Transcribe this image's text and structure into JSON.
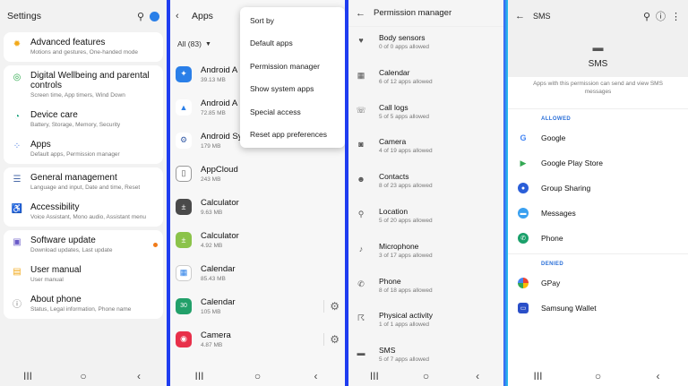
{
  "settings": {
    "title": "Settings",
    "items": [
      {
        "title": "Advanced features",
        "sub": "Motions and gestures, One-handed mode",
        "color": "#f2a91a"
      },
      {
        "title": "Digital Wellbeing and parental controls",
        "sub": "Screen time, App timers, Wind Down",
        "color": "#2aa84a"
      },
      {
        "title": "Device care",
        "sub": "Battery, Storage, Memory, Security",
        "color": "#14a07a"
      },
      {
        "title": "Apps",
        "sub": "Default apps, Permission manager",
        "color": "#3e73e0"
      },
      {
        "title": "General management",
        "sub": "Language and input, Date and time, Reset",
        "color": "#4a6aa8"
      },
      {
        "title": "Accessibility",
        "sub": "Voice Assistant, Mono audio, Assistant menu",
        "color": "#2aa84a"
      },
      {
        "title": "Software update",
        "sub": "Download updates, Last update",
        "color": "#6a5ac8"
      },
      {
        "title": "User manual",
        "sub": "User manual",
        "color": "#f2a91a"
      },
      {
        "title": "About phone",
        "sub": "Status, Legal information, Phone name",
        "color": "#777777"
      }
    ]
  },
  "apps": {
    "title": "Apps",
    "filter": "All (83)",
    "list": [
      {
        "name": "Android A",
        "size": "39.13 MB",
        "color": "#2a7fe8",
        "glyph": "✦"
      },
      {
        "name": "Android A",
        "size": "72.85 MB",
        "color": "#ffffff",
        "glyph": "▲"
      },
      {
        "name": "Android System WebView",
        "size": "179 MB",
        "color": "#3a5fa8",
        "glyph": "⚙"
      },
      {
        "name": "AppCloud",
        "size": "243 MB",
        "color": "#ffffff",
        "glyph": "▯"
      },
      {
        "name": "Calculator",
        "size": "9.63 MB",
        "color": "#4a4a4a",
        "glyph": "±"
      },
      {
        "name": "Calculator",
        "size": "4.92 MB",
        "color": "#8bc34a",
        "glyph": "±"
      },
      {
        "name": "Calendar",
        "size": "85.43 MB",
        "color": "#ffffff",
        "glyph": "▦"
      },
      {
        "name": "Calendar",
        "size": "105 MB",
        "color": "#22a06a",
        "glyph": "30"
      },
      {
        "name": "Camera",
        "size": "4.87 MB",
        "color": "#e8304a",
        "glyph": "◉"
      }
    ],
    "menu": [
      "Sort by",
      "Default apps",
      "Permission manager",
      "Show system apps",
      "Special access",
      "Reset app preferences"
    ]
  },
  "permissions": {
    "title": "Permission manager",
    "list": [
      {
        "name": "Body sensors",
        "count": "0 of 0 apps allowed",
        "icon": "♥"
      },
      {
        "name": "Calendar",
        "count": "6 of 12 apps allowed",
        "icon": "▦"
      },
      {
        "name": "Call logs",
        "count": "5 of 5 apps allowed",
        "icon": "☏"
      },
      {
        "name": "Camera",
        "count": "4 of 19 apps allowed",
        "icon": "◙"
      },
      {
        "name": "Contacts",
        "count": "8 of 23 apps allowed",
        "icon": "☻"
      },
      {
        "name": "Location",
        "count": "5 of 20 apps allowed",
        "icon": "⚲"
      },
      {
        "name": "Microphone",
        "count": "3 of 17 apps allowed",
        "icon": "♪"
      },
      {
        "name": "Phone",
        "count": "8 of 18 apps allowed",
        "icon": "✆"
      },
      {
        "name": "Physical activity",
        "count": "1 of 1 apps allowed",
        "icon": "☈"
      },
      {
        "name": "SMS",
        "count": "5 of 7 apps allowed",
        "icon": "▬"
      }
    ]
  },
  "sms": {
    "title": "SMS",
    "hero_title": "SMS",
    "description": "Apps with this permission can send and view SMS messages",
    "allowed_label": "ALLOWED",
    "denied_label": "DENIED",
    "allowed": [
      {
        "name": "Google",
        "color": "#ffffff",
        "glyph": "G"
      },
      {
        "name": "Google Play Store",
        "color": "#ffffff",
        "glyph": "▶"
      },
      {
        "name": "Group Sharing",
        "color": "#2a5ed8",
        "glyph": "●"
      },
      {
        "name": "Messages",
        "color": "#3aa0f0",
        "glyph": "▬"
      },
      {
        "name": "Phone",
        "color": "#1aa06a",
        "glyph": "✆"
      }
    ],
    "denied": [
      {
        "name": "GPay",
        "color": "#ffffff",
        "glyph": "●"
      },
      {
        "name": "Samsung Wallet",
        "color": "#2a4fc8",
        "glyph": "▭"
      }
    ]
  },
  "navbar": {
    "recent": "III",
    "home": "○",
    "back": "‹"
  }
}
